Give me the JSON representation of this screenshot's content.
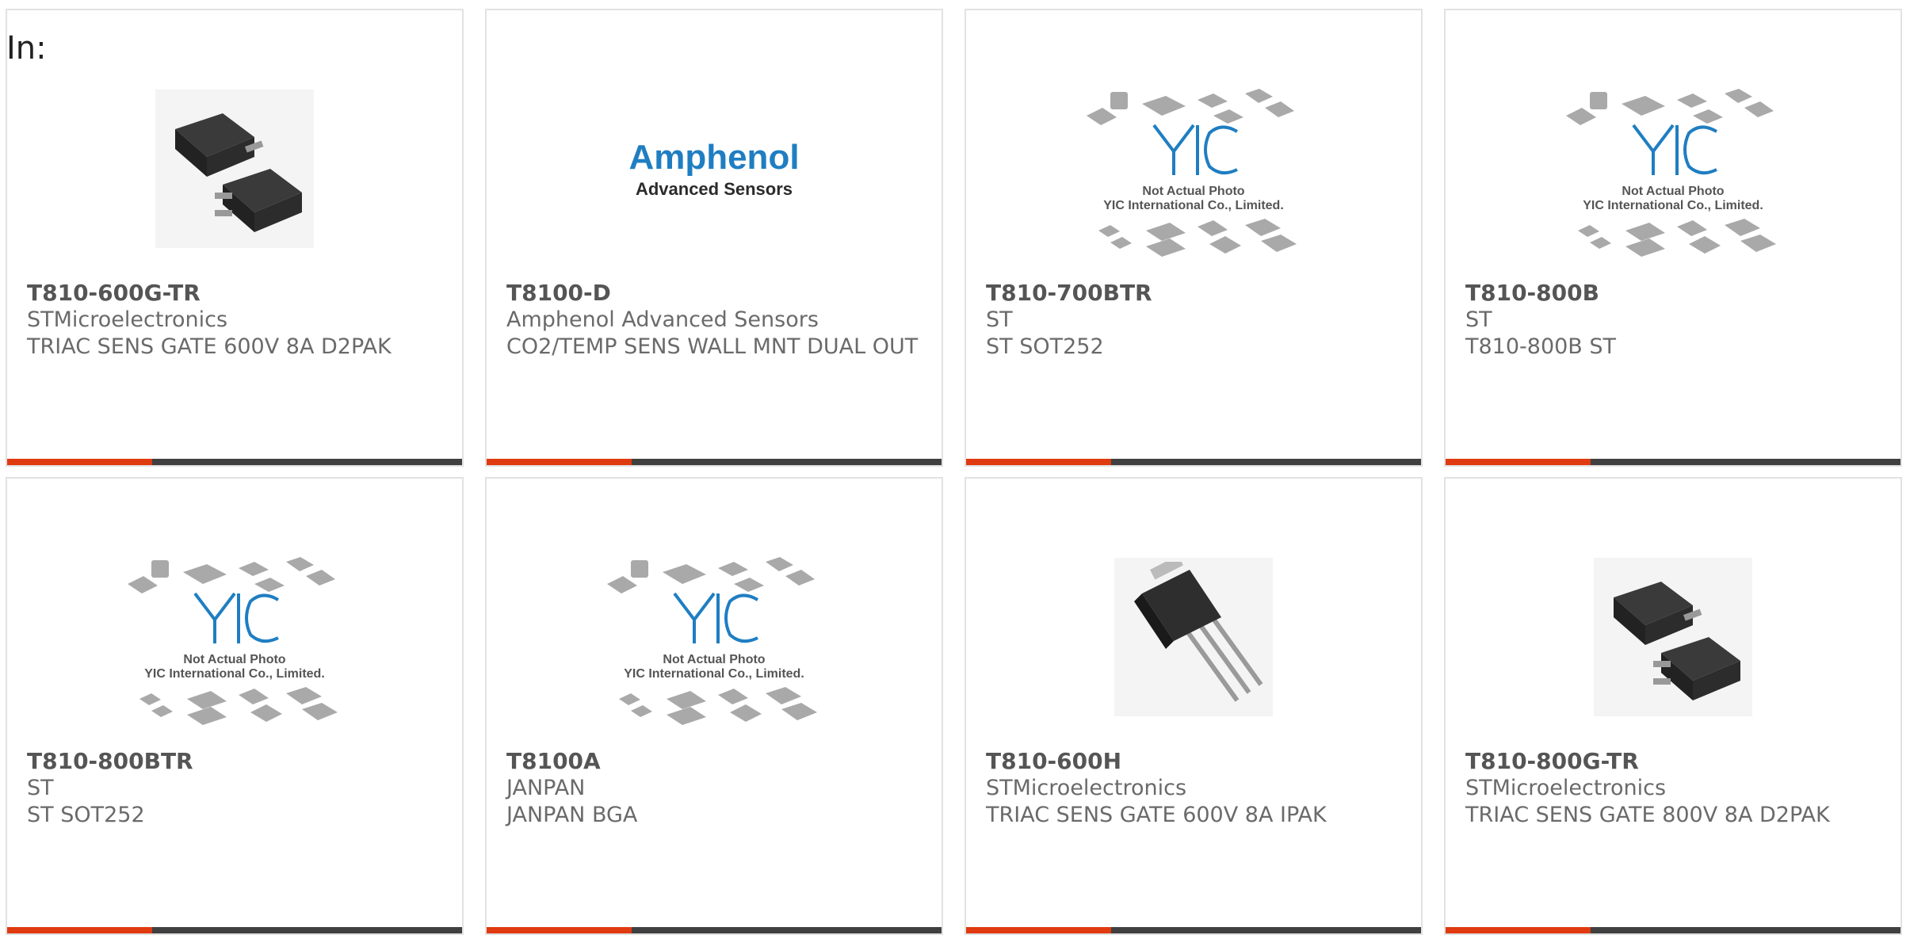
{
  "filter": {
    "label": "In:"
  },
  "placeholder_image": {
    "line1": "Not Actual Photo",
    "line2": "YIC International Co., Limited."
  },
  "brand_logo": {
    "line1": "Amphenol",
    "line2": "Advanced Sensors"
  },
  "products": [
    {
      "part": "T810-600G-TR",
      "maker": "STMicroelectronics",
      "desc": "TRIAC SENS GATE 600V 8A D2PAK",
      "image": "d2pak-photo"
    },
    {
      "part": "T8100-D",
      "maker": "Amphenol Advanced Sensors",
      "desc": "CO2/TEMP SENS WALL MNT DUAL OUT",
      "image": "brand-logo"
    },
    {
      "part": "T810-700BTR",
      "maker": "ST",
      "desc": "ST SOT252",
      "image": "yic-placeholder"
    },
    {
      "part": "T810-800B",
      "maker": "ST",
      "desc": "T810-800B ST",
      "image": "yic-placeholder"
    },
    {
      "part": "T810-800BTR",
      "maker": "ST",
      "desc": "ST SOT252",
      "image": "yic-placeholder"
    },
    {
      "part": "T8100A",
      "maker": "JANPAN",
      "desc": "JANPAN BGA",
      "image": "yic-placeholder"
    },
    {
      "part": "T810-600H",
      "maker": "STMicroelectronics",
      "desc": "TRIAC SENS GATE 600V 8A IPAK",
      "image": "ipak-photo"
    },
    {
      "part": "T810-800G-TR",
      "maker": "STMicroelectronics",
      "desc": "TRIAC SENS GATE 800V 8A D2PAK",
      "image": "d2pak-photo"
    }
  ],
  "colors": {
    "accent": "#e03a10",
    "bar": "#404040",
    "border": "#e2e2e2",
    "logo_blue": "#1f7ec2"
  }
}
